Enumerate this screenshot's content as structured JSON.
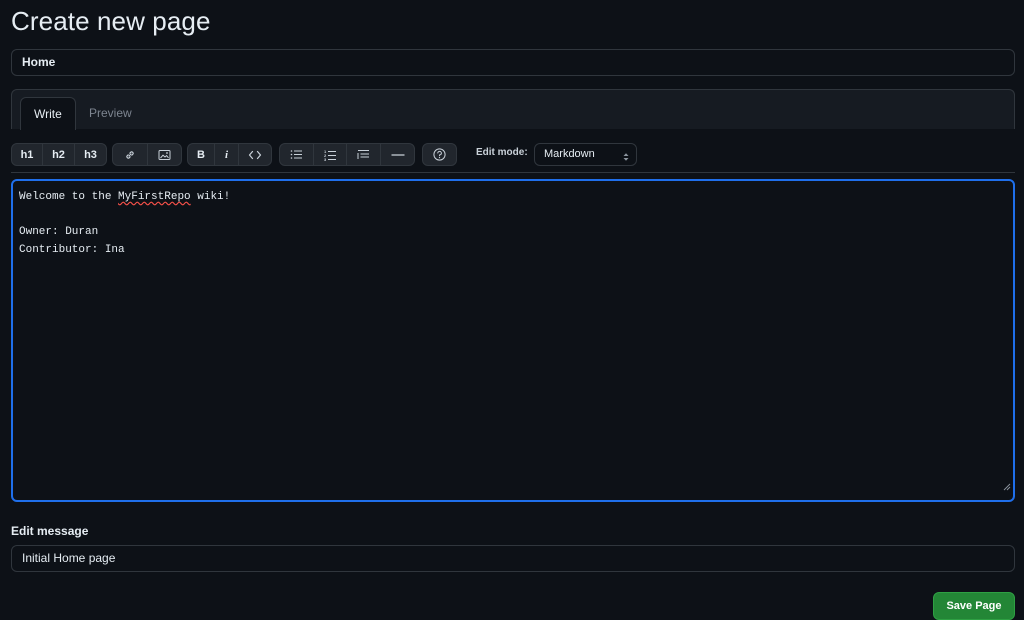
{
  "page": {
    "title": "Create new page"
  },
  "form": {
    "page_title_value": "Home"
  },
  "tabs": [
    {
      "label": "Write",
      "active": true
    },
    {
      "label": "Preview",
      "active": false
    }
  ],
  "toolbar": {
    "h1": "h1",
    "h2": "h2",
    "h3": "h3",
    "bold": "B",
    "italic": "i",
    "icons": [
      "link-icon",
      "image-icon",
      "code-icon",
      "unordered-list-icon",
      "ordered-list-icon",
      "blockquote-icon",
      "horizontal-rule-icon",
      "help-icon"
    ],
    "edit_mode_label": "Edit mode:",
    "edit_mode_value": "Markdown"
  },
  "editor": {
    "line1_pre": "Welcome to the ",
    "line1_link": "MyFirstRepo",
    "line1_post": " wiki!",
    "line2": "",
    "line3": "Owner: Duran",
    "line4": "Contributor: Ina"
  },
  "message": {
    "label": "Edit message",
    "value": "Initial Home page"
  },
  "actions": {
    "save_label": "Save Page"
  },
  "colors": {
    "background": "#0d1117",
    "border": "#30363d",
    "focus": "#1f6feb",
    "primary_button": "#238636"
  }
}
